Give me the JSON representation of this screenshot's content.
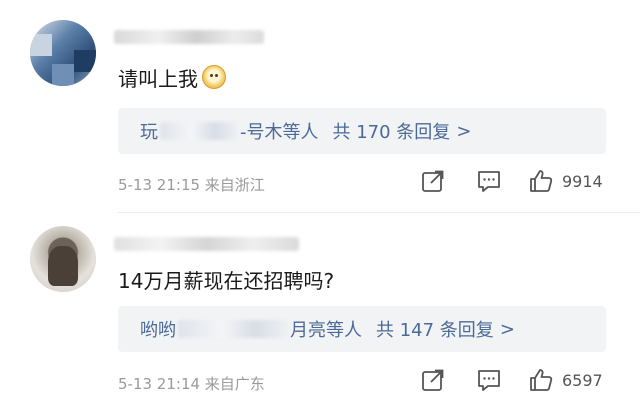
{
  "comments": [
    {
      "text": "请叫上我",
      "emoji": "doge-emoji",
      "replies": {
        "prefix": "玩",
        "suffix": "-号木等人",
        "count_text": "共 170 条回复",
        "chevron": ">"
      },
      "meta": "5-13  21:15  来自浙江",
      "likes": "9914"
    },
    {
      "text": "14万月薪现在还招聘吗?",
      "replies": {
        "prefix": "哟哟",
        "suffix": "月亮等人",
        "count_text": "共 147 条回复",
        "chevron": ">"
      },
      "meta": "5-13  21:14  来自广东",
      "likes": "6597"
    }
  ],
  "icons": [
    "share-icon",
    "comment-icon",
    "like-icon"
  ],
  "colors": {
    "link": "#4b6a98",
    "meta": "#9a9a9a",
    "reply_bg": "#f2f3f5"
  }
}
